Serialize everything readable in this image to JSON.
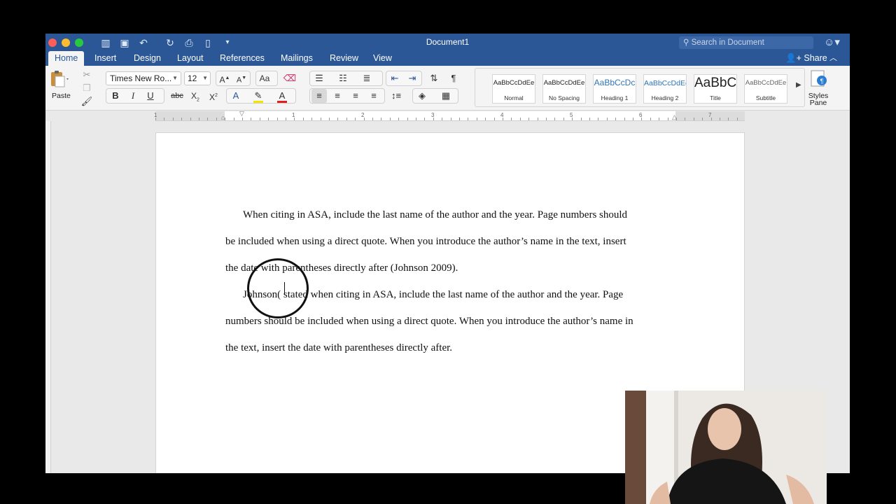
{
  "app": {
    "document_title": "Document1",
    "search_placeholder": "Search in Document",
    "share_label": "Share"
  },
  "tabs": [
    {
      "label": "Home"
    },
    {
      "label": "Insert"
    },
    {
      "label": "Design"
    },
    {
      "label": "Layout"
    },
    {
      "label": "References"
    },
    {
      "label": "Mailings"
    },
    {
      "label": "Review"
    },
    {
      "label": "View"
    }
  ],
  "ribbon": {
    "paste_label": "Paste",
    "font_name": "Times New Ro...",
    "font_size": "12",
    "styles_pane_label_1": "Styles",
    "styles_pane_label_2": "Pane",
    "styles": [
      {
        "sample": "AaBbCcDdEe",
        "name": "Normal"
      },
      {
        "sample": "AaBbCcDdEe",
        "name": "No Spacing"
      },
      {
        "sample": "AaBbCcDc",
        "name": "Heading 1"
      },
      {
        "sample": "AaBbCcDdEe",
        "name": "Heading 2"
      },
      {
        "sample": "AaBbC",
        "name": "Title"
      },
      {
        "sample": "AaBbCcDdEe",
        "name": "Subtitle"
      }
    ]
  },
  "ruler": {
    "numbers": [
      "1",
      "1",
      "2",
      "3",
      "4",
      "5",
      "6",
      "7"
    ]
  },
  "document": {
    "lines": [
      "When citing in ASA, include the last name of the author and the year. Page numbers should",
      "be included when using a direct quote. When you introduce the author’s name in the text, insert",
      "the date with parentheses directly after (Johnson 2009).",
      "Johnson( stated when citing in ASA, include the last name of the author and the year. Page",
      "numbers should be included when using a direct quote. When you introduce the author’s name in",
      "the text, insert the date with parentheses directly after."
    ]
  },
  "colors": {
    "title_bar": "#2b5797",
    "ribbon_bg": "#f4f4f4",
    "font_color_underline": "#e02020",
    "highlight_underline": "#f2e600"
  }
}
